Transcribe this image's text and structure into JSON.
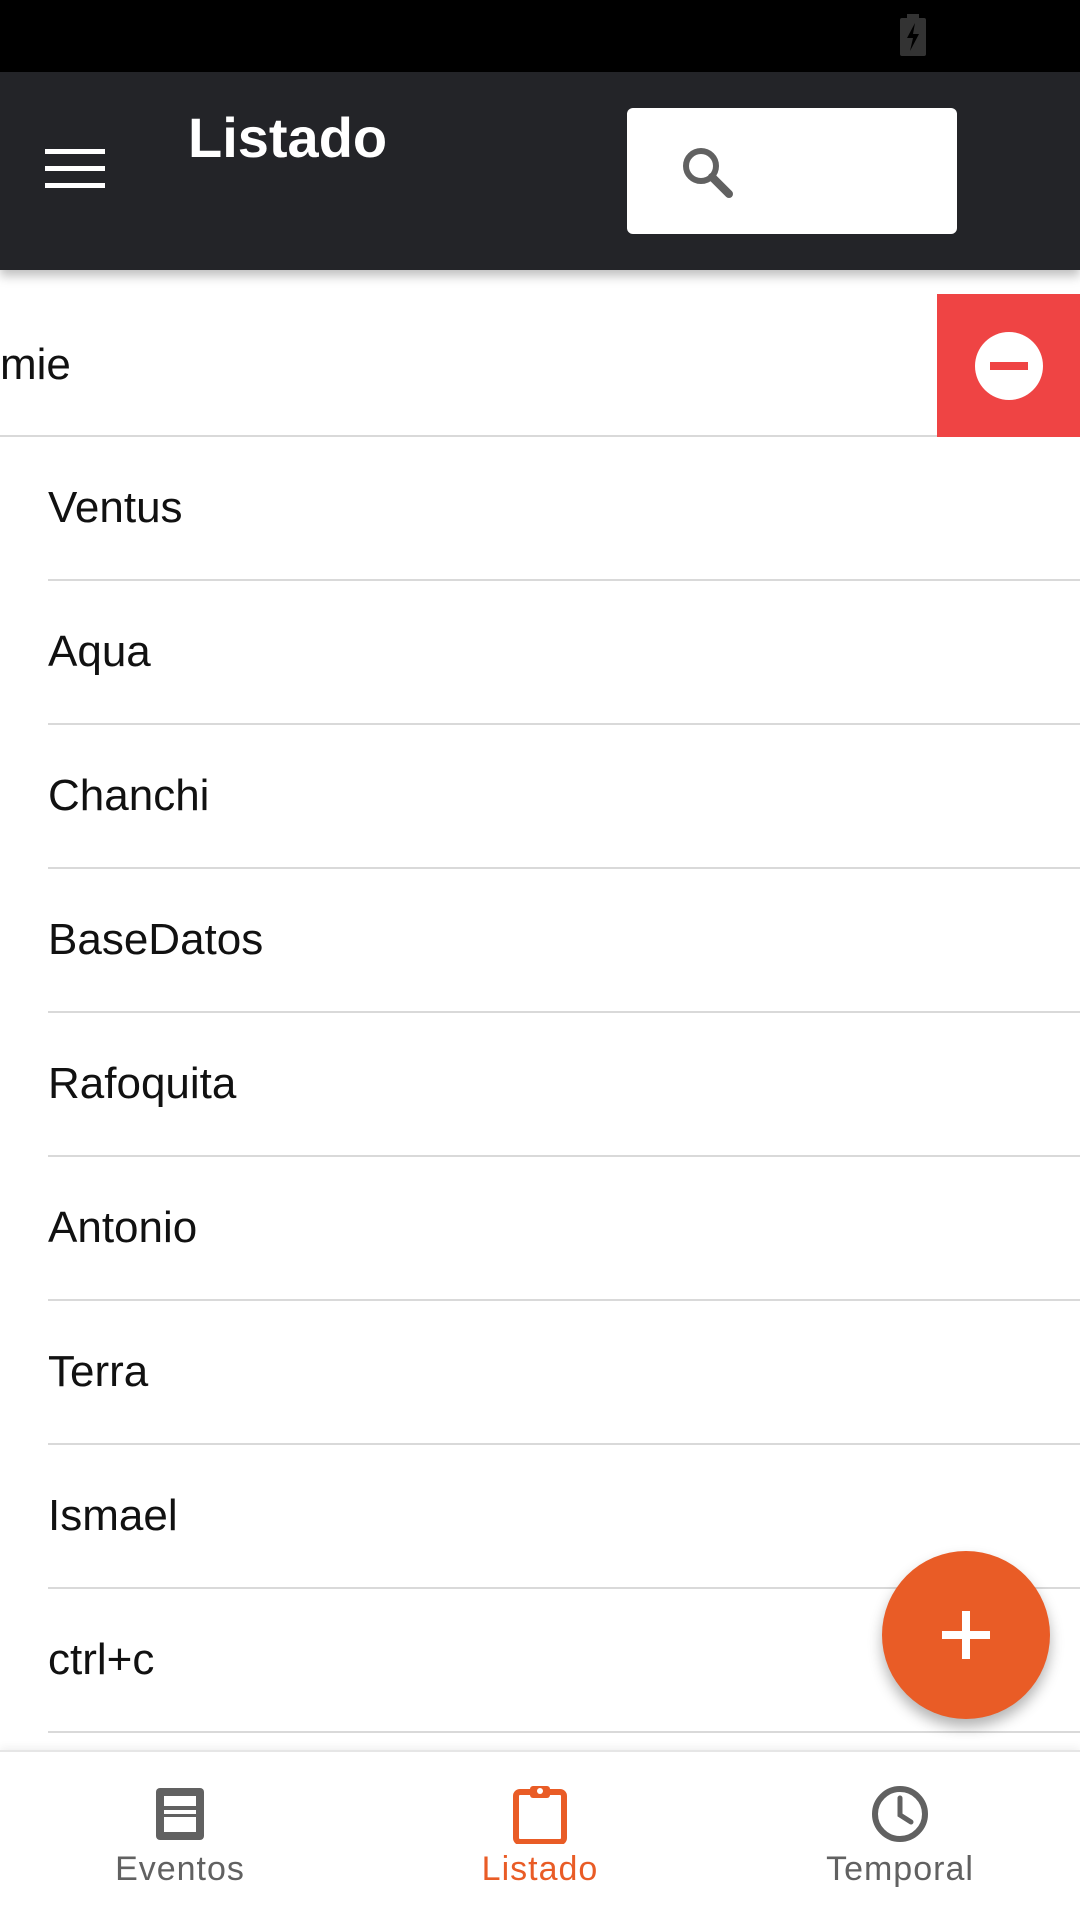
{
  "app_bar": {
    "title": "Listado",
    "menu_icon": "hamburger-menu-icon",
    "search": {
      "icon": "search-icon",
      "value": "",
      "placeholder": ""
    }
  },
  "swiped_item": {
    "label": "mie",
    "action_icon": "remove-circle-icon",
    "action_color": "#ef4444"
  },
  "items": [
    {
      "label": "Ventus"
    },
    {
      "label": "Aqua"
    },
    {
      "label": "Chanchi"
    },
    {
      "label": "BaseDatos"
    },
    {
      "label": "Rafoquita"
    },
    {
      "label": "Antonio"
    },
    {
      "label": "Terra"
    },
    {
      "label": "Ismael"
    },
    {
      "label": "ctrl+c"
    },
    {
      "label": ""
    }
  ],
  "fab": {
    "icon": "plus-icon",
    "color": "#e95c26"
  },
  "bottom_nav": {
    "items": [
      {
        "label": "Eventos",
        "icon": "calendar-page-icon",
        "active": false
      },
      {
        "label": "Listado",
        "icon": "clipboard-icon",
        "active": true
      },
      {
        "label": "Temporal",
        "icon": "clock-icon",
        "active": false
      }
    ],
    "active_color": "#e95c26",
    "inactive_color": "#616161"
  },
  "colors": {
    "app_bar": "#232428",
    "status_bar": "#000000"
  }
}
